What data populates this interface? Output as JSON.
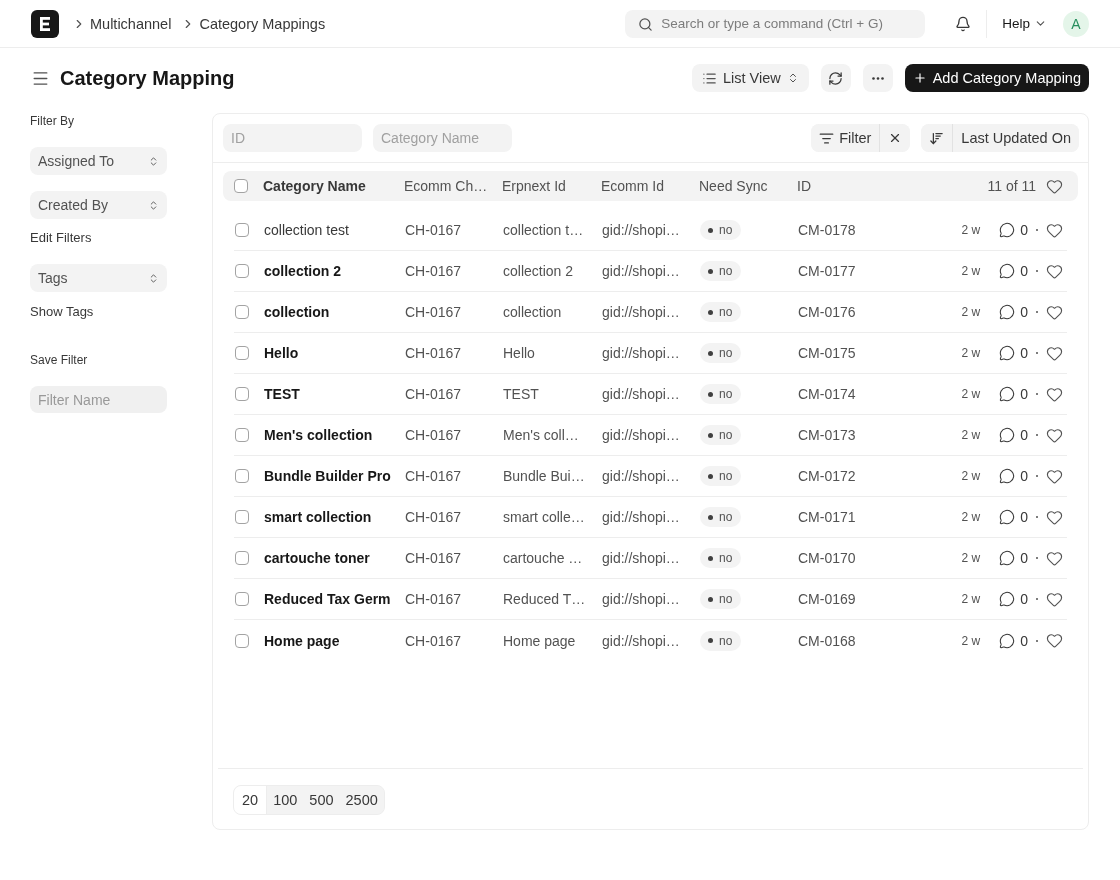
{
  "navbar": {
    "breadcrumbs": [
      "Multichannel",
      "Category Mappings"
    ],
    "search": {
      "placeholder": "Search or type a command (Ctrl + G)"
    },
    "help": "Help",
    "avatar": "A"
  },
  "page_header": {
    "title": "Category Mapping",
    "view_switcher": "List View",
    "primary_action": "Add Category Mapping"
  },
  "sidebar": {
    "filter_by": "Filter By",
    "group_by": [
      "Assigned To",
      "Created By"
    ],
    "edit_filters": "Edit Filters",
    "tags": "Tags",
    "show_tags": "Show Tags",
    "save_filter": "Save Filter",
    "filter_name": {
      "placeholder": "Filter Name"
    }
  },
  "filter_bar": {
    "fields": [
      {
        "placeholder": "ID"
      },
      {
        "placeholder": "Category Name"
      }
    ],
    "filter_button": "Filter",
    "sort_button": "Last Updated On"
  },
  "table": {
    "select_all": {
      "checked": false
    },
    "columns": [
      {
        "label": "Category Name",
        "kind": "title"
      },
      {
        "label": "Ecomm Ch…",
        "kind": "text"
      },
      {
        "label": "Erpnext Id",
        "kind": "text"
      },
      {
        "label": "Ecomm Id",
        "kind": "text"
      },
      {
        "label": "Need Sync",
        "kind": "badge"
      },
      {
        "label": "ID",
        "kind": "text"
      }
    ],
    "count": "11 of 11",
    "rows": [
      {
        "checked": false,
        "unread": false,
        "cells": [
          "collection test",
          "CH-0167",
          "collection t…",
          "gid://shopi…",
          "no",
          "CM-0178"
        ],
        "modified": "2 w",
        "comments": "0",
        "liked": false
      },
      {
        "checked": false,
        "unread": true,
        "cells": [
          "collection 2",
          "CH-0167",
          "collection 2",
          "gid://shopi…",
          "no",
          "CM-0177"
        ],
        "modified": "2 w",
        "comments": "0",
        "liked": false
      },
      {
        "checked": false,
        "unread": true,
        "cells": [
          "collection",
          "CH-0167",
          "collection",
          "gid://shopi…",
          "no",
          "CM-0176"
        ],
        "modified": "2 w",
        "comments": "0",
        "liked": false
      },
      {
        "checked": false,
        "unread": true,
        "cells": [
          "Hello",
          "CH-0167",
          "Hello",
          "gid://shopi…",
          "no",
          "CM-0175"
        ],
        "modified": "2 w",
        "comments": "0",
        "liked": false
      },
      {
        "checked": false,
        "unread": true,
        "cells": [
          "TEST",
          "CH-0167",
          "TEST",
          "gid://shopi…",
          "no",
          "CM-0174"
        ],
        "modified": "2 w",
        "comments": "0",
        "liked": false
      },
      {
        "checked": false,
        "unread": true,
        "cells": [
          "Men's collection",
          "CH-0167",
          "Men's coll…",
          "gid://shopi…",
          "no",
          "CM-0173"
        ],
        "modified": "2 w",
        "comments": "0",
        "liked": false
      },
      {
        "checked": false,
        "unread": true,
        "cells": [
          "Bundle Builder Pro",
          "CH-0167",
          "Bundle Bui…",
          "gid://shopi…",
          "no",
          "CM-0172"
        ],
        "modified": "2 w",
        "comments": "0",
        "liked": false
      },
      {
        "checked": false,
        "unread": true,
        "cells": [
          "smart collection",
          "CH-0167",
          "smart colle…",
          "gid://shopi…",
          "no",
          "CM-0171"
        ],
        "modified": "2 w",
        "comments": "0",
        "liked": false
      },
      {
        "checked": false,
        "unread": true,
        "cells": [
          "cartouche toner",
          "CH-0167",
          "cartouche …",
          "gid://shopi…",
          "no",
          "CM-0170"
        ],
        "modified": "2 w",
        "comments": "0",
        "liked": false
      },
      {
        "checked": false,
        "unread": true,
        "cells": [
          "Reduced Tax Germ",
          "CH-0167",
          "Reduced T…",
          "gid://shopi…",
          "no",
          "CM-0169"
        ],
        "modified": "2 w",
        "comments": "0",
        "liked": false
      },
      {
        "checked": false,
        "unread": true,
        "cells": [
          "Home page",
          "CH-0167",
          "Home page",
          "gid://shopi…",
          "no",
          "CM-0168"
        ],
        "modified": "2 w",
        "comments": "0",
        "liked": false
      }
    ]
  },
  "pagination": [
    {
      "label": "20",
      "selected": true
    },
    {
      "label": "100",
      "selected": false
    },
    {
      "label": "500",
      "selected": false
    },
    {
      "label": "2500",
      "selected": false
    }
  ]
}
